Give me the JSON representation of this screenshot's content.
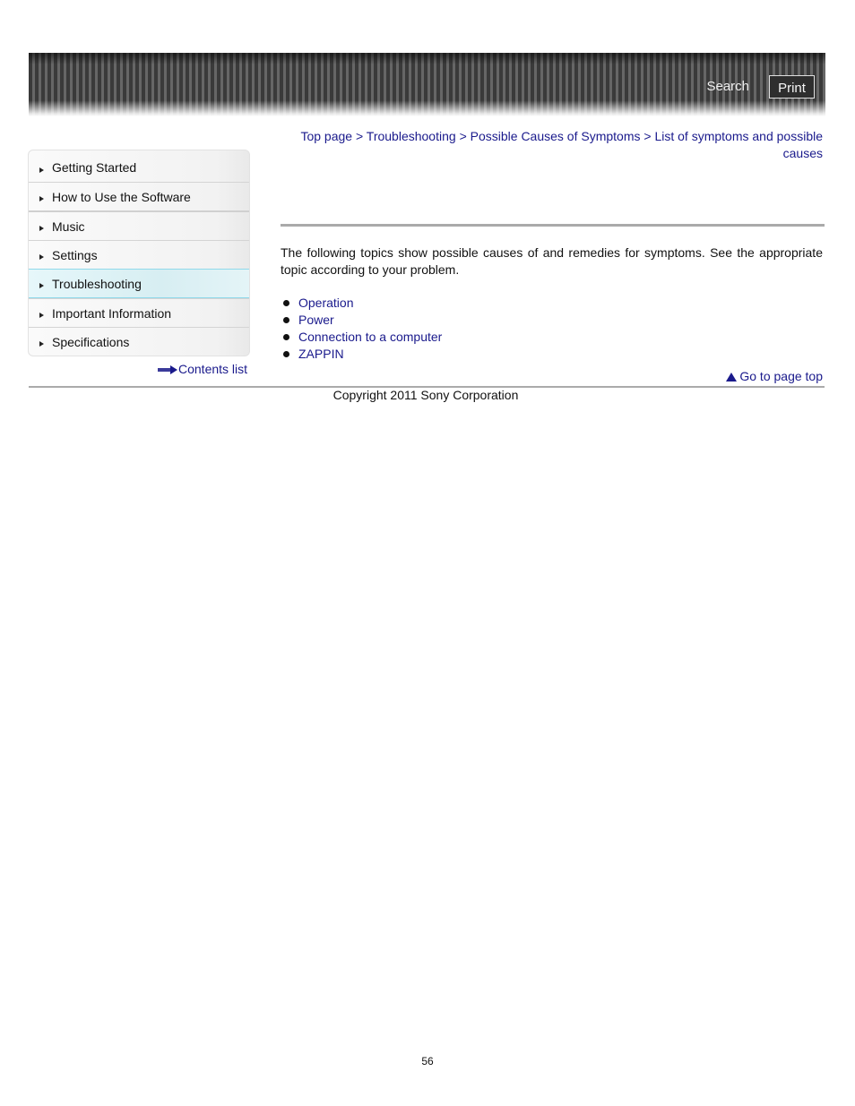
{
  "header": {
    "search_label": "Search",
    "print_label": "Print"
  },
  "sidebar": {
    "items": [
      {
        "label": "Getting Started",
        "active": false
      },
      {
        "label": "How to Use the Software",
        "active": false
      },
      {
        "label": "Music",
        "active": false
      },
      {
        "label": "Settings",
        "active": false
      },
      {
        "label": "Troubleshooting",
        "active": true
      },
      {
        "label": "Important Information",
        "active": false
      },
      {
        "label": "Specifications",
        "active": false
      }
    ],
    "contents_list_label": "Contents list"
  },
  "breadcrumb": {
    "items": [
      "Top page",
      "Troubleshooting",
      "Possible Causes of Symptoms",
      "List of symptoms and possible causes"
    ],
    "separator": ">"
  },
  "main": {
    "intro": "The following topics show possible causes of and remedies for symptoms. See the appropriate topic according to your problem.",
    "topics": [
      "Operation",
      "Power",
      "Connection to a computer",
      "ZAPPIN"
    ],
    "page_top_label": "Go to page top"
  },
  "footer": {
    "copyright": "Copyright 2011 Sony Corporation",
    "page_number": "56"
  },
  "colors": {
    "link": "#1a1a8c",
    "active_item_bg": "#d7eef2",
    "active_item_border": "#8fd9ea",
    "rule": "#aaaaaa"
  }
}
